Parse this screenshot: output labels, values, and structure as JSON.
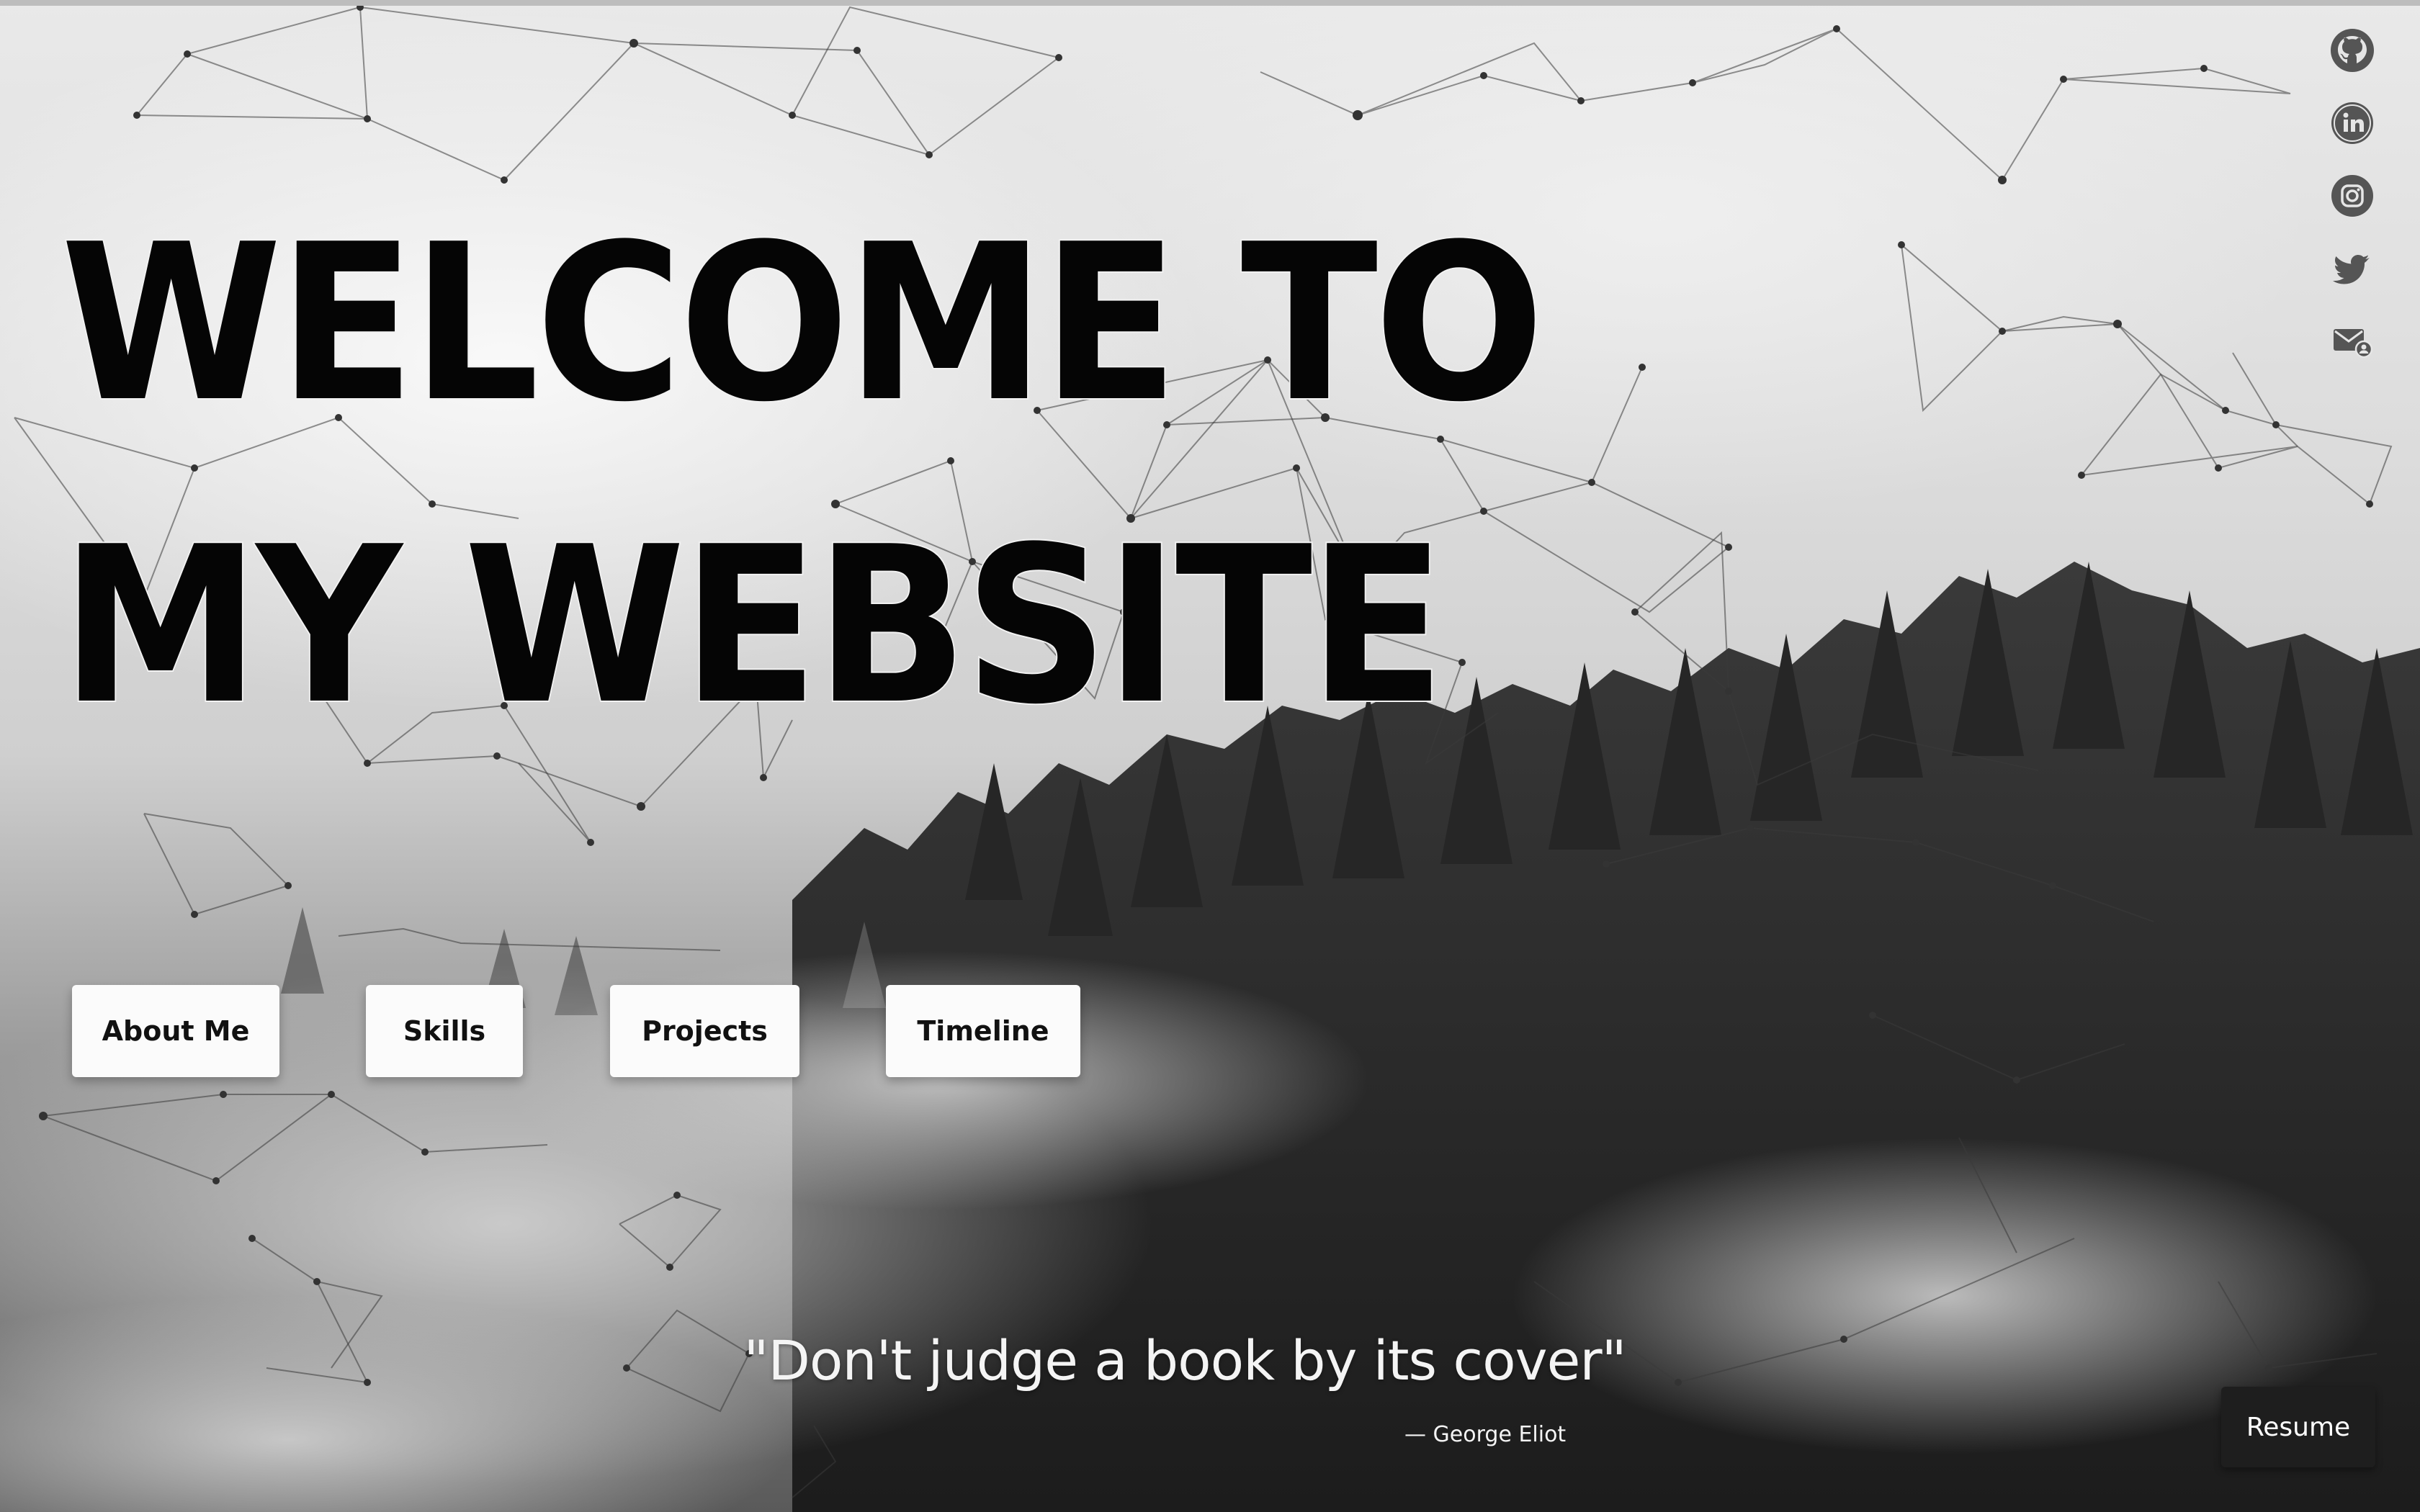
{
  "hero": {
    "title": "WELCOME TO MY WEBSITE"
  },
  "nav": {
    "items": [
      {
        "label": "About Me"
      },
      {
        "label": "Skills"
      },
      {
        "label": "Projects"
      },
      {
        "label": "Timeline"
      }
    ]
  },
  "social": {
    "items": [
      {
        "icon": "github-icon"
      },
      {
        "icon": "linkedin-icon"
      },
      {
        "icon": "instagram-icon"
      },
      {
        "icon": "twitter-icon"
      },
      {
        "icon": "email-icon"
      }
    ]
  },
  "quote": {
    "text": "\"Don't judge a book by its cover\"",
    "author": "— George Eliot"
  },
  "resume": {
    "label": "Resume"
  },
  "colors": {
    "title": "#050505",
    "button_bg": "#fbfbfb",
    "resume_bg": "#1e1e1e",
    "icon": "#555555",
    "quote_text": "#f4f4f4"
  }
}
